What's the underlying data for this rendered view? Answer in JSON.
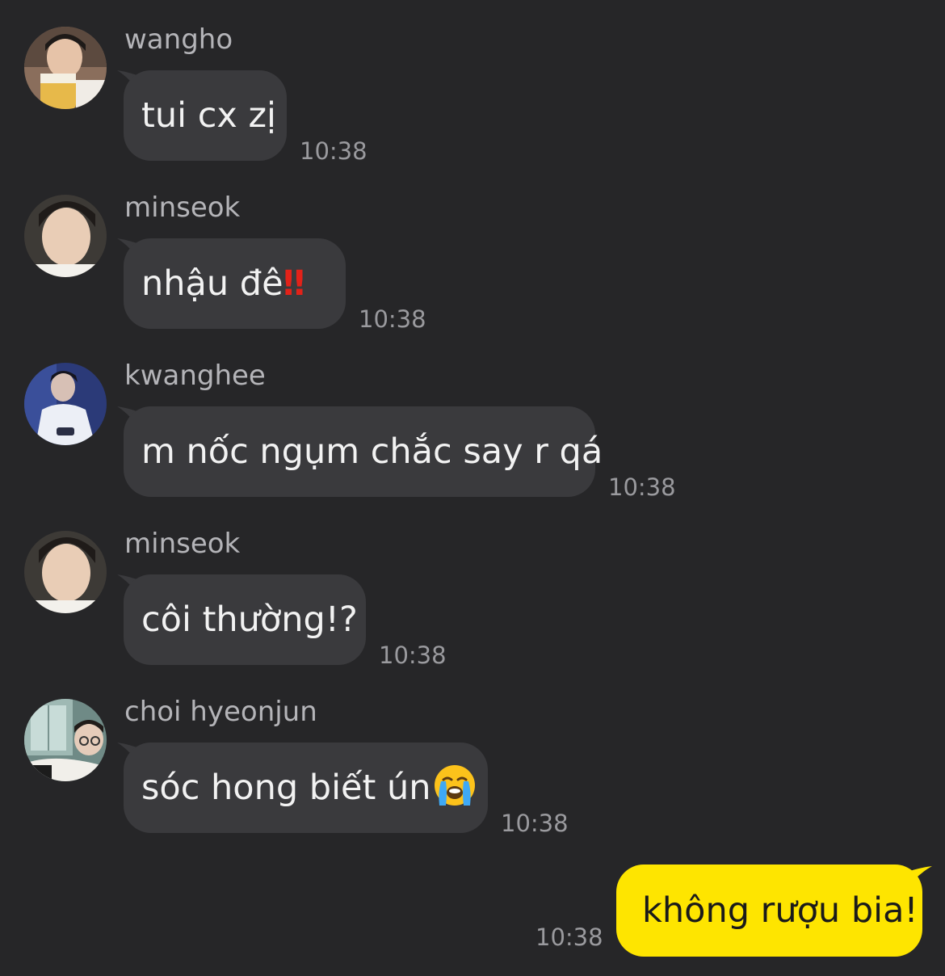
{
  "messages": [
    {
      "sender": "wangho",
      "text": "tui cx zị",
      "time": "10:38"
    },
    {
      "sender": "minseok",
      "text": "nhậu đê",
      "emoji": "‼",
      "emoji_icon": "double-exclamation-icon",
      "time": "10:38"
    },
    {
      "sender": "kwanghee",
      "text": "m nốc ngụm chắc say r qá",
      "time": "10:38"
    },
    {
      "sender": "minseok",
      "text": "côi thường!?",
      "time": "10:38"
    },
    {
      "sender": "choi hyeonjun",
      "text": "sóc hong biết ún",
      "emoji_icon": "loudly-crying-face-icon",
      "time": "10:38"
    }
  ],
  "own_message": {
    "text": "không rượu bia!",
    "time": "10:38"
  },
  "colors": {
    "background": "#262628",
    "incoming_bubble": "#3a3a3d",
    "outgoing_bubble": "#fee500",
    "sender_name": "#b4b4b8",
    "timestamp": "#9a9a9e"
  }
}
